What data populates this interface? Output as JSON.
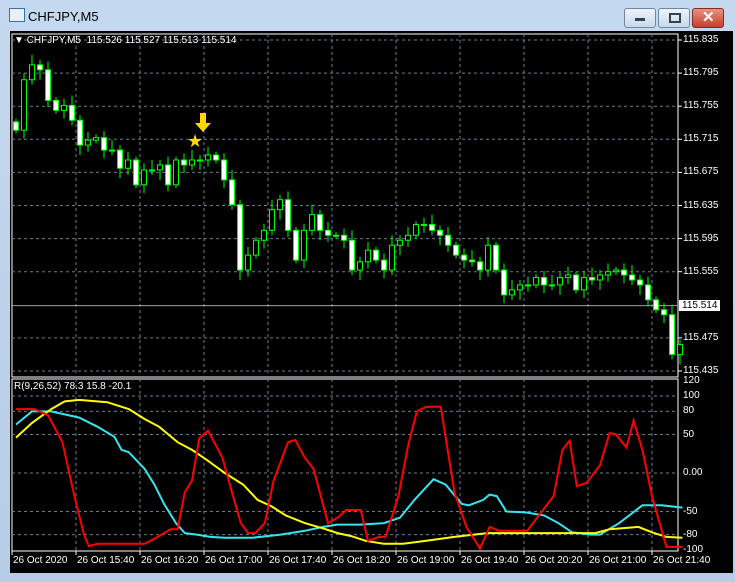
{
  "window": {
    "title": "CHFJPY,M5"
  },
  "header": {
    "symbol": "CHFJPY,M5",
    "ohlc": "115.526 115.527 115.513 115.514"
  },
  "price_axis": {
    "labels": [
      "115.835",
      "115.795",
      "115.755",
      "115.715",
      "115.675",
      "115.635",
      "115.595",
      "115.555",
      "115.475",
      "115.435"
    ],
    "current_price": "115.514"
  },
  "indicator": {
    "label": "R(9,26,52) 78.3 15.8 -20.1",
    "levels": [
      "120",
      "100",
      "80",
      "50",
      "0.00",
      "-50",
      "-80",
      "-100"
    ]
  },
  "time_axis": [
    "26 Oct 2020",
    "26 Oct 15:40",
    "26 Oct 16:20",
    "26 Oct 17:00",
    "26 Oct 17:40",
    "26 Oct 18:20",
    "26 Oct 19:00",
    "26 Oct 19:40",
    "26 Oct 20:20",
    "26 Oct 21:00",
    "26 Oct 21:40"
  ],
  "colors": {
    "candle": "#00ff00",
    "red": "#ff0000",
    "cyan": "#33e6f0",
    "yellow": "#ffff00",
    "arrow": "#ffd700"
  },
  "chart_data": {
    "type": "candlestick",
    "ylim": [
      115.435,
      115.835
    ],
    "closes": [
      115.726,
      115.787,
      115.805,
      115.799,
      115.762,
      115.75,
      115.756,
      115.738,
      115.708,
      115.714,
      115.717,
      115.702,
      115.702,
      115.68,
      115.69,
      115.66,
      115.678,
      115.678,
      115.684,
      115.66,
      115.69,
      115.684,
      115.69,
      115.69,
      115.696,
      115.69,
      115.666,
      115.636,
      115.557,
      115.575,
      115.593,
      115.605,
      115.63,
      115.642,
      115.605,
      115.569,
      115.605,
      115.624,
      115.605,
      115.599,
      115.599,
      115.593,
      115.557,
      115.567,
      115.581,
      115.569,
      115.557,
      115.587,
      115.593,
      115.599,
      115.612,
      115.612,
      115.605,
      115.599,
      115.587,
      115.575,
      115.569,
      115.567,
      115.557,
      115.587,
      115.557,
      115.527,
      115.533,
      115.539,
      115.539,
      115.548,
      115.539,
      115.539,
      115.548,
      115.551,
      115.533,
      115.548,
      115.545,
      115.551,
      115.555,
      115.557,
      115.551,
      115.545,
      115.539,
      115.521,
      115.509,
      115.503,
      115.455,
      115.467
    ],
    "oscillator": {
      "range": [
        -120,
        120
      ],
      "red": [
        [
          0,
          83
        ],
        [
          2.3,
          83
        ],
        [
          4,
          75
        ],
        [
          5.8,
          40
        ],
        [
          7.3,
          -30
        ],
        [
          8.5,
          -80
        ],
        [
          9.1,
          -95
        ],
        [
          10.2,
          -92
        ],
        [
          16.1,
          -92
        ],
        [
          17.9,
          -82
        ],
        [
          19.3,
          -73
        ],
        [
          20.2,
          -73
        ],
        [
          21.1,
          -25
        ],
        [
          22,
          -10
        ],
        [
          22.9,
          45
        ],
        [
          24,
          55
        ],
        [
          25.8,
          20
        ],
        [
          27,
          -25
        ],
        [
          28.1,
          -65
        ],
        [
          29,
          -78
        ],
        [
          29.9,
          -78
        ],
        [
          31.1,
          -65
        ],
        [
          32.2,
          -10
        ],
        [
          34,
          40
        ],
        [
          34.9,
          43
        ],
        [
          36.1,
          20
        ],
        [
          37.2,
          5
        ],
        [
          39,
          -65
        ],
        [
          40.2,
          -58
        ],
        [
          41.3,
          -48
        ],
        [
          43.1,
          -48
        ],
        [
          44,
          -88
        ],
        [
          45.4,
          -83
        ],
        [
          46.2,
          -83
        ],
        [
          47.8,
          -30
        ],
        [
          49,
          35
        ],
        [
          50.1,
          80
        ],
        [
          51.3,
          86
        ],
        [
          53.1,
          86
        ],
        [
          54.8,
          -25
        ],
        [
          56.3,
          -70
        ],
        [
          58,
          -98
        ],
        [
          59.2,
          -70
        ],
        [
          60.4,
          -75
        ],
        [
          63.9,
          -75
        ],
        [
          67.2,
          -30
        ],
        [
          68.3,
          30
        ],
        [
          69.2,
          42
        ],
        [
          70.1,
          -17
        ],
        [
          71.3,
          -13
        ],
        [
          73,
          10
        ],
        [
          74.2,
          52
        ],
        [
          75,
          50
        ],
        [
          76.3,
          33
        ],
        [
          77.2,
          68
        ],
        [
          78.3,
          30
        ],
        [
          79.5,
          -30
        ],
        [
          81.3,
          -96
        ],
        [
          83.3,
          -96
        ]
      ],
      "cyan": [
        [
          0,
          63
        ],
        [
          2,
          80
        ],
        [
          4.4,
          80
        ],
        [
          7.9,
          72
        ],
        [
          10.2,
          60
        ],
        [
          12.3,
          47
        ],
        [
          13.2,
          30
        ],
        [
          14.1,
          27
        ],
        [
          16.1,
          5
        ],
        [
          17.3,
          -15
        ],
        [
          18.5,
          -40
        ],
        [
          20,
          -65
        ],
        [
          21.1,
          -78
        ],
        [
          22.6,
          -80
        ],
        [
          24.3,
          -83
        ],
        [
          26.1,
          -84
        ],
        [
          29.6,
          -84
        ],
        [
          33.1,
          -80
        ],
        [
          36.1,
          -75
        ],
        [
          38.4,
          -70
        ],
        [
          40.2,
          -67
        ],
        [
          43.1,
          -67
        ],
        [
          46,
          -65
        ],
        [
          48,
          -58
        ],
        [
          49.8,
          -35
        ],
        [
          52.2,
          -8
        ],
        [
          53.7,
          -15
        ],
        [
          55.7,
          -40
        ],
        [
          56.6,
          -42
        ],
        [
          58.4,
          -35
        ],
        [
          59.2,
          -28
        ],
        [
          60.1,
          -30
        ],
        [
          61.3,
          -50
        ],
        [
          63.6,
          -51
        ],
        [
          66,
          -55
        ],
        [
          67.8,
          -65
        ],
        [
          69.5,
          -77
        ],
        [
          71.9,
          -80
        ],
        [
          73,
          -80
        ],
        [
          75.4,
          -65
        ],
        [
          78.3,
          -42
        ],
        [
          80.7,
          -42
        ],
        [
          83.3,
          -45
        ]
      ],
      "yellow": [
        [
          0,
          46
        ],
        [
          2,
          65
        ],
        [
          4.4,
          83
        ],
        [
          6.1,
          93
        ],
        [
          7.9,
          95
        ],
        [
          11.4,
          92
        ],
        [
          14.1,
          83
        ],
        [
          16.1,
          70
        ],
        [
          17.9,
          60
        ],
        [
          20.2,
          40
        ],
        [
          22,
          30
        ],
        [
          23.7,
          18
        ],
        [
          26.1,
          0
        ],
        [
          28.4,
          -15
        ],
        [
          30.2,
          -35
        ],
        [
          31.9,
          -43
        ],
        [
          33.7,
          -55
        ],
        [
          36.1,
          -65
        ],
        [
          38.4,
          -72
        ],
        [
          40.2,
          -78
        ],
        [
          41.9,
          -82
        ],
        [
          43.7,
          -88
        ],
        [
          46,
          -92
        ],
        [
          48.4,
          -92
        ],
        [
          51.3,
          -88
        ],
        [
          54.8,
          -83
        ],
        [
          58.9,
          -78
        ],
        [
          63,
          -78
        ],
        [
          68.9,
          -78
        ],
        [
          72.4,
          -78
        ],
        [
          74.2,
          -73
        ],
        [
          77.8,
          -70
        ],
        [
          79.5,
          -77
        ],
        [
          81.3,
          -83
        ],
        [
          83.3,
          -84
        ]
      ]
    }
  }
}
